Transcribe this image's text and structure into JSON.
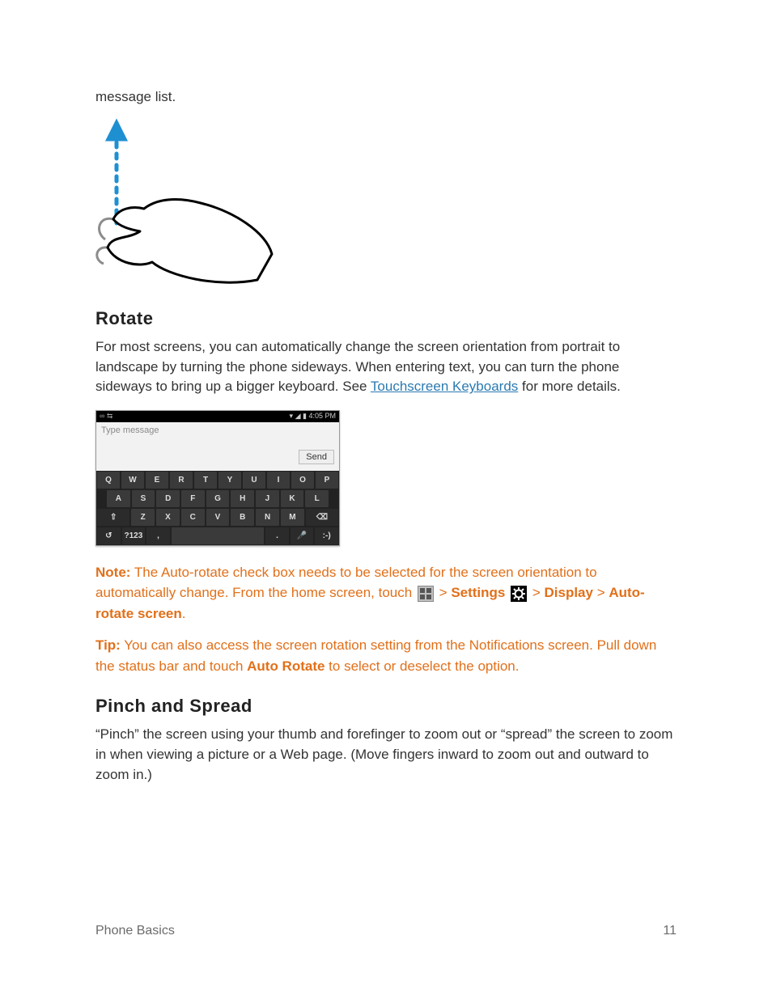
{
  "intro_fragment": "message list.",
  "section_rotate": "Rotate",
  "rotate_body_pre": "For most screens, you can automatically change the screen orientation from portrait to landscape by turning the phone sideways. When entering text, you can turn the phone sideways to bring up a bigger keyboard. See ",
  "rotate_link": "Touchscreen Keyboards",
  "rotate_body_post": " for more details.",
  "phone": {
    "time": "4:05 PM",
    "placeholder": "Type message",
    "send": "Send",
    "rows": [
      [
        "Q",
        "W",
        "E",
        "R",
        "T",
        "Y",
        "U",
        "I",
        "O",
        "P"
      ],
      [
        "A",
        "S",
        "D",
        "F",
        "G",
        "H",
        "J",
        "K",
        "L"
      ],
      [
        "⇧",
        "Z",
        "X",
        "C",
        "V",
        "B",
        "N",
        "M",
        "⌫"
      ],
      [
        "↺",
        "?123",
        ",",
        " ",
        ".",
        "🎤",
        ":-)"
      ]
    ]
  },
  "note_label": "Note:",
  "note_1": " The Auto-rotate check box needs to be selected for the screen orientation to automatically change. From the home screen, touch ",
  "note_gt": " > ",
  "note_settings": "Settings",
  "note_display": "Display",
  "note_auto": "Auto-rotate screen",
  "note_end": ".",
  "tip_label": "Tip:",
  "tip_1": " You can also access the screen rotation setting from the Notifications screen. Pull down the status bar and touch ",
  "tip_auto": "Auto Rotate",
  "tip_2": " to select or deselect the option.",
  "section_pinch": "Pinch and Spread",
  "pinch_body": "“Pinch” the screen using your thumb and forefinger to zoom out or “spread” the screen to zoom in when viewing a picture or a Web page. (Move fingers inward to zoom out and outward to zoom in.)",
  "footer_left": "Phone Basics",
  "footer_right": "11"
}
